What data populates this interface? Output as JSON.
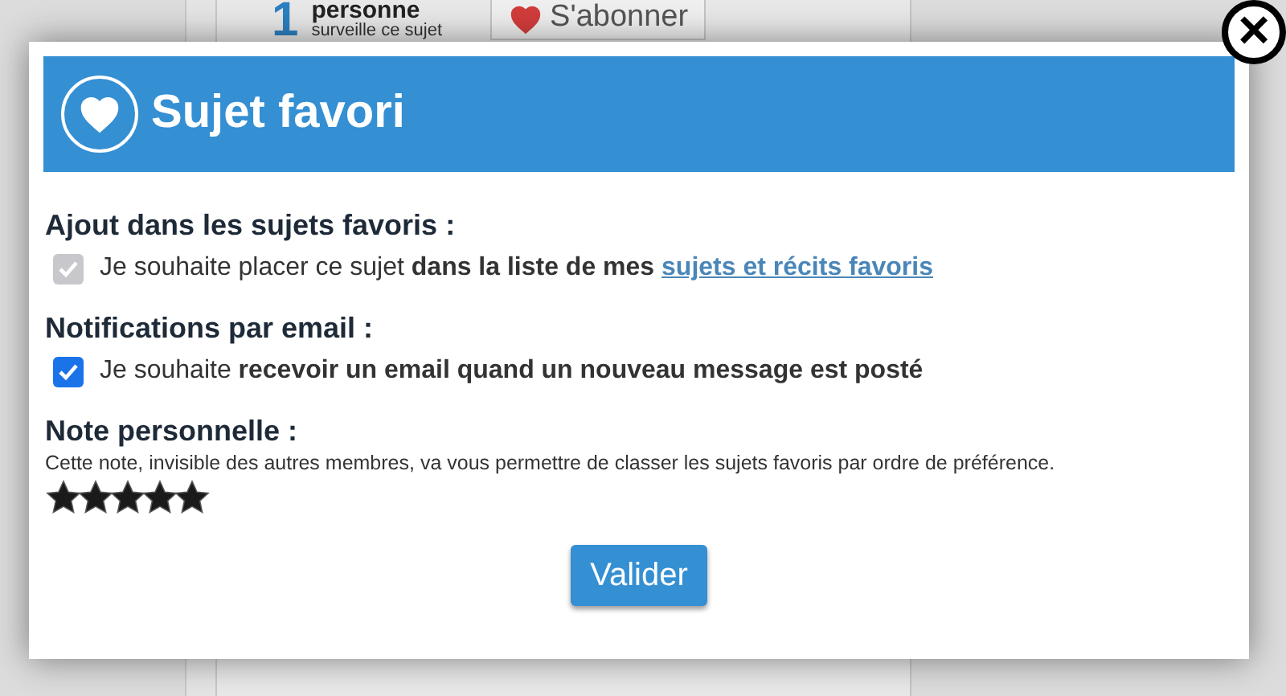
{
  "background": {
    "count": "1",
    "count_label": "personne",
    "count_caption": "surveille ce sujet",
    "subscribe_button": "S'abonner"
  },
  "dialog": {
    "title": "Sujet favori",
    "close_label": "×",
    "sections": [
      {
        "heading": "Ajout dans les sujets favoris :",
        "kind": "checkbox",
        "checked": true,
        "disabled": true,
        "text": "Je souhaite placer ce sujet **dans la liste de mes**",
        "link": "sujets et récits favoris"
      },
      {
        "heading": "Notifications par email :",
        "kind": "checkbox",
        "checked": true,
        "disabled": false,
        "text": "Je souhaite **recevoir un email quand un nouveau message est posté**"
      },
      {
        "heading": "Note personnelle :",
        "kind": "rating",
        "text": "Cette note, invisible des autres membres, va vous permettre de classer les sujets favoris par ordre de préférence.",
        "stars": 5
      }
    ],
    "submit": "Valider"
  }
}
